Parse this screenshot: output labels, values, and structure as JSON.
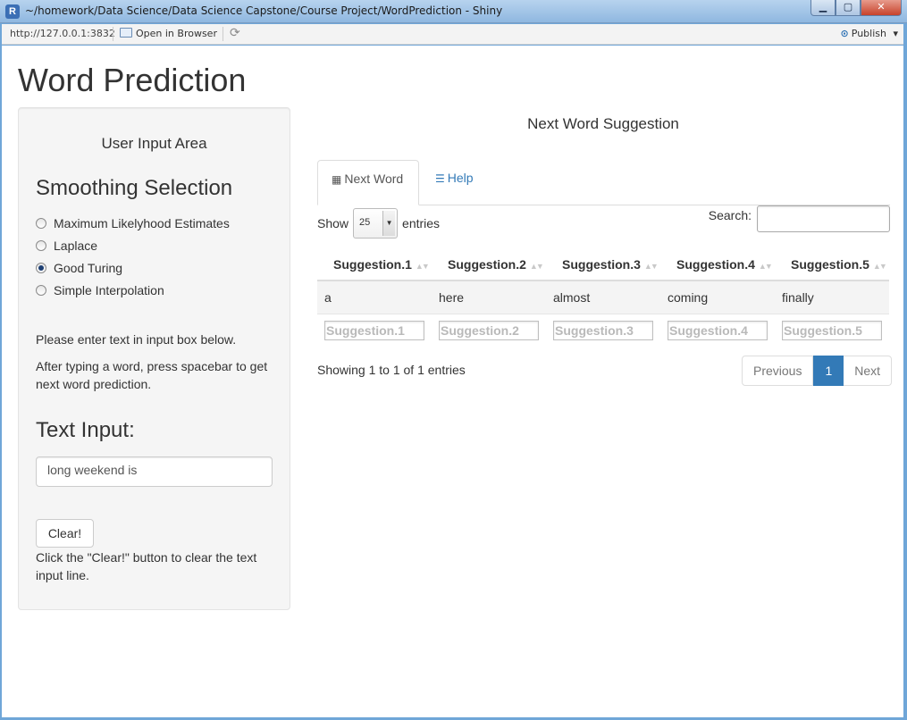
{
  "window": {
    "title": "~/homework/Data Science/Data Science Capstone/Course Project/WordPrediction - Shiny",
    "app_icon": "R",
    "minimize_glyph": "▁",
    "maximize_glyph": "▢",
    "close_glyph": "✕"
  },
  "toolbar": {
    "url": "http://127.0.0.1:3832",
    "open_browser_label": "Open in Browser",
    "refresh_glyph": "⟳",
    "publish_glyph": "⊙",
    "publish_label": "Publish",
    "publish_arrow": "▾"
  },
  "page": {
    "title": "Word Prediction"
  },
  "sidebar": {
    "heading": "User Input Area",
    "smoothing_heading": "Smoothing Selection",
    "options": [
      {
        "label": "Maximum Likelyhood Estimates",
        "checked": false
      },
      {
        "label": "Laplace",
        "checked": false
      },
      {
        "label": "Good Turing",
        "checked": true
      },
      {
        "label": "Simple Interpolation",
        "checked": false
      }
    ],
    "instruction_1": "Please enter text in input box below.",
    "instruction_2": "After typing a word, press spacebar to get next word prediction.",
    "text_input_heading": "Text Input:",
    "text_input_value": "long weekend is",
    "clear_label": "Clear!",
    "clear_help": "Click the \"Clear!\" button to clear the text input line."
  },
  "main": {
    "title": "Next Word Suggestion",
    "tabs": [
      {
        "label": "Next Word",
        "icon": "table-icon",
        "active": true
      },
      {
        "label": "Help",
        "icon": "list-icon",
        "active": false
      }
    ],
    "tab_icons": {
      "table": "▦",
      "list": "☰"
    },
    "show_label": "Show",
    "page_length": "25",
    "entries_label": "entries",
    "search_label": "Search:",
    "sort_glyph": "▲▼",
    "columns": [
      "Suggestion.1",
      "Suggestion.2",
      "Suggestion.3",
      "Suggestion.4",
      "Suggestion.5"
    ],
    "rows": [
      [
        "a",
        "here",
        "almost",
        "coming",
        "finally"
      ]
    ],
    "filter_placeholders": [
      "Suggestion.1",
      "Suggestion.2",
      "Suggestion.3",
      "Suggestion.4",
      "Suggestion.5"
    ],
    "info": "Showing 1 to 1 of 1 entries",
    "pagination": {
      "previous": "Previous",
      "current": "1",
      "next": "Next"
    }
  },
  "colors": {
    "accent": "#337ab7",
    "titlebar": "#8fb7e0"
  }
}
